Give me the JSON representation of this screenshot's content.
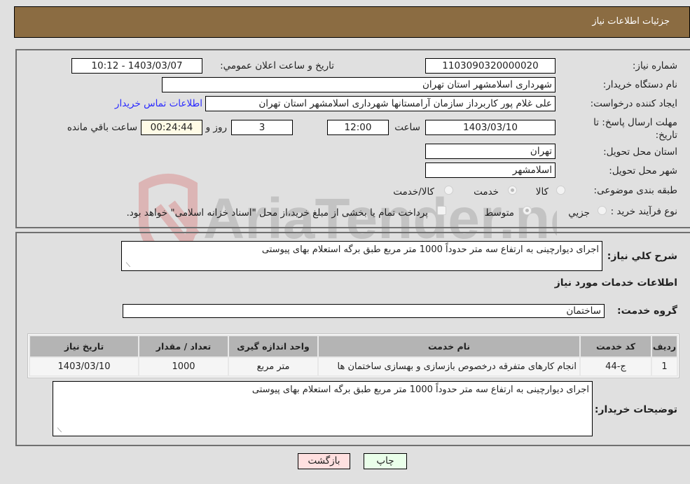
{
  "header": {
    "title": "جزئیات اطلاعات نیاز"
  },
  "form": {
    "need_number": {
      "label": "شماره نیاز:",
      "value": "1103090320000020"
    },
    "announce_datetime": {
      "label": "تاریخ و ساعت اعلان عمومي:",
      "value": "1403/03/07 - 10:12"
    },
    "buyer_org": {
      "label": "نام دستگاه خریدار:",
      "value": "شهرداری اسلامشهر استان تهران"
    },
    "requester": {
      "label": "ایجاد کننده درخواست:",
      "value": "علی غلام پور کاربرداز سازمان آرامستانها شهرداری اسلامشهر استان تهران"
    },
    "contact_link": "اطلاعات تماس خریدار",
    "deadline": {
      "label": "مهلت ارسال پاسخ: تا تاریخ:",
      "date": "1403/03/10",
      "time_label": "ساعت",
      "time": "12:00",
      "days": "3",
      "days_label": "روز و",
      "remaining": "00:24:44",
      "remaining_label": "ساعت باقي مانده"
    },
    "province": {
      "label": "استان محل تحویل:",
      "value": "تهران"
    },
    "city": {
      "label": "شهر محل تحویل:",
      "value": "اسلامشهر"
    },
    "category": {
      "label": "طبقه بندی موضوعی:",
      "options": [
        {
          "label": "کالا",
          "selected": false
        },
        {
          "label": "خدمت",
          "selected": true
        },
        {
          "label": "کالا/خدمت",
          "selected": false
        }
      ]
    },
    "purchase_type": {
      "label": "نوع فرآیند خرید :",
      "options": [
        {
          "label": "جزيي",
          "selected": false
        },
        {
          "label": "متوسط",
          "selected": true
        }
      ],
      "treasury_note": "پرداخت تمام یا بخشی از مبلغ خرید،از محل \"اسناد خزانه اسلامی\" خواهد بود.",
      "treasury_checked": false
    }
  },
  "details": {
    "summary_label": "شرح كلي نياز:",
    "summary_value": "اجرای دیوارچینی به ارتفاع سه متر حدوداً 1000 متر مربع طبق برگه استعلام بهای پیوستی",
    "services_heading": "اطلاعات خدمات مورد نیاز",
    "service_group_label": "گروه خدمت:",
    "service_group_value": "ساختمان",
    "table": {
      "headers": [
        "ردیف",
        "کد خدمت",
        "نام خدمت",
        "واحد اندازه گیری",
        "تعداد / مقدار",
        "تاریخ نیاز"
      ],
      "rows": [
        [
          "1",
          "ج-44",
          "انجام کارهای متفرقه درخصوص بازسازی و بهسازی ساختمان ها",
          "متر مربع",
          "1000",
          "1403/03/10"
        ]
      ]
    },
    "buyer_notes_label": "توضیحات خریدار:",
    "buyer_notes_value": "اجرای دیوارچینی به ارتفاع سه متر حدوداً 1000 متر مربع طبق برگه استعلام بهای پیوستی"
  },
  "buttons": {
    "print": "چاپ",
    "back": "بازگشت"
  },
  "watermark": {
    "text": "AriaTender.neT"
  }
}
